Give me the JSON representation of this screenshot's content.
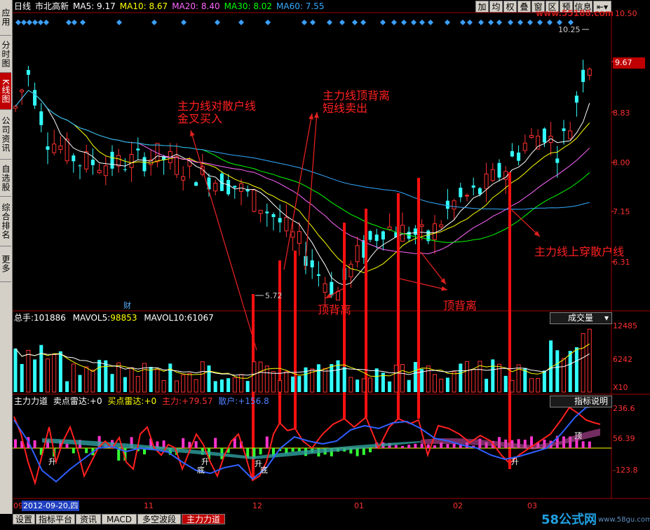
{
  "header": {
    "period": "日线",
    "stock": "市北高新",
    "ma": [
      {
        "label": "MA5:",
        "value": "9.17",
        "color": "#ffffff"
      },
      {
        "label": "MA10:",
        "value": "8.67",
        "color": "#ffff00"
      },
      {
        "label": "MA20:",
        "value": "8.40",
        "color": "#ff66ff"
      },
      {
        "label": "MA30:",
        "value": "8.02",
        "color": "#00ff00"
      },
      {
        "label": "MA60:",
        "value": "7.55",
        "color": "#33aaff"
      }
    ],
    "buttons": [
      "加",
      "均",
      "权",
      "叠",
      "窗",
      "区",
      "预",
      "信息"
    ],
    "price_top": "10.50"
  },
  "sidebar": {
    "tabs": [
      "应用",
      "分时图",
      "K线图",
      "公司资讯",
      "自选股",
      "综合排名",
      "更多"
    ]
  },
  "price_axis": {
    "labels": [
      "9.67",
      "8.83",
      "8.00",
      "7.15",
      "6.31"
    ]
  },
  "kline": {
    "markers": {
      "high": "10.25",
      "low": "5.72",
      "fin": "财"
    },
    "ann": {
      "cross_l1": "主力线对散户线",
      "cross_l2": "金叉买入",
      "top_l1": "主力线顶背离",
      "top_l2": "短线卖出",
      "above": "主力线上穿散户线",
      "div1": "顶背离",
      "div2": "顶背离"
    }
  },
  "volume": {
    "label": "总手:",
    "value": "101886",
    "mavol5_label": "MAVOL5:",
    "mavol5": "98853",
    "mavol10_label": "MAVOL10:",
    "mavol10": "61067",
    "selector": "成交量",
    "axis": [
      "12485",
      "6242",
      "X10"
    ]
  },
  "indicator": {
    "name": "主力力道",
    "sell_label": "卖点雷达:",
    "sell_val": "+0",
    "buy_label": "买点雷达:",
    "buy_val": "+0",
    "main_label": "主力:",
    "main_val": "+79.57",
    "retail_label": "散户:",
    "retail_val": "+156.8",
    "help": "指标说明",
    "axis": [
      "236.6",
      "56.39",
      "-123.8"
    ],
    "marks": {
      "sheng1": "升",
      "sheng2": "升",
      "sheng3": "升",
      "sheng4": "升",
      "di1": "底",
      "di2": "底",
      "ding": "顶"
    }
  },
  "date_axis": {
    "cursor": "2012-09-20,四",
    "first": "09",
    "months": [
      "11",
      "12",
      "01",
      "02",
      "03"
    ]
  },
  "bottom_tabs": [
    "设置",
    "指标平台",
    "资讯",
    "MACD",
    "多空波段",
    "主力力道"
  ],
  "watermark": {
    "text": "58公式网",
    "url": "www.58gu.com",
    "top_logo": "www.55188.com"
  },
  "chart_data": [
    {
      "type": "candlestick",
      "title": "日线 市北高新",
      "x": [
        "09",
        "11",
        "12",
        "01",
        "02",
        "03"
      ],
      "ylim": [
        5.5,
        10.5
      ],
      "series": [
        {
          "name": "MA5",
          "values": [
            9.17
          ]
        },
        {
          "name": "MA10",
          "values": [
            8.67
          ]
        },
        {
          "name": "MA20",
          "values": [
            8.4
          ]
        },
        {
          "name": "MA30",
          "values": [
            8.02
          ]
        },
        {
          "name": "MA60",
          "values": [
            7.55
          ]
        }
      ],
      "annotations": [
        "10.25",
        "5.72"
      ]
    },
    {
      "type": "bar",
      "title": "成交量",
      "ylim": [
        0,
        12485
      ],
      "series": [
        {
          "name": "总手",
          "values": [
            101886
          ]
        },
        {
          "name": "MAVOL5",
          "values": [
            98853
          ]
        },
        {
          "name": "MAVOL10",
          "values": [
            61067
          ]
        }
      ]
    },
    {
      "type": "line",
      "title": "主力力道",
      "ylim": [
        -123.8,
        236.6
      ],
      "series": [
        {
          "name": "主力",
          "values": [
            79.57
          ]
        },
        {
          "name": "散户",
          "values": [
            156.8
          ]
        }
      ]
    }
  ]
}
